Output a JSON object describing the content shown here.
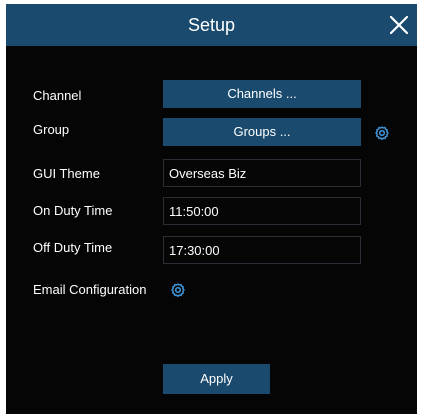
{
  "dialog": {
    "title": "Setup"
  },
  "rows": {
    "channel": {
      "label": "Channel",
      "button": "Channels ..."
    },
    "group": {
      "label": "Group",
      "button": "Groups ..."
    },
    "gui_theme": {
      "label": "GUI Theme",
      "value": "Overseas Biz"
    },
    "on_duty": {
      "label": "On Duty Time",
      "value": "11:50:00"
    },
    "off_duty": {
      "label": "Off Duty Time",
      "value": "17:30:00"
    },
    "email": {
      "label": "Email Configuration"
    }
  },
  "footer": {
    "apply_label": "Apply"
  },
  "icons": {
    "close": "close-icon",
    "gear": "gear-icon"
  },
  "colors": {
    "background": "#050505",
    "accent": "#1a4a6d",
    "gear": "#3f8fd0",
    "text": "#ffffff"
  }
}
